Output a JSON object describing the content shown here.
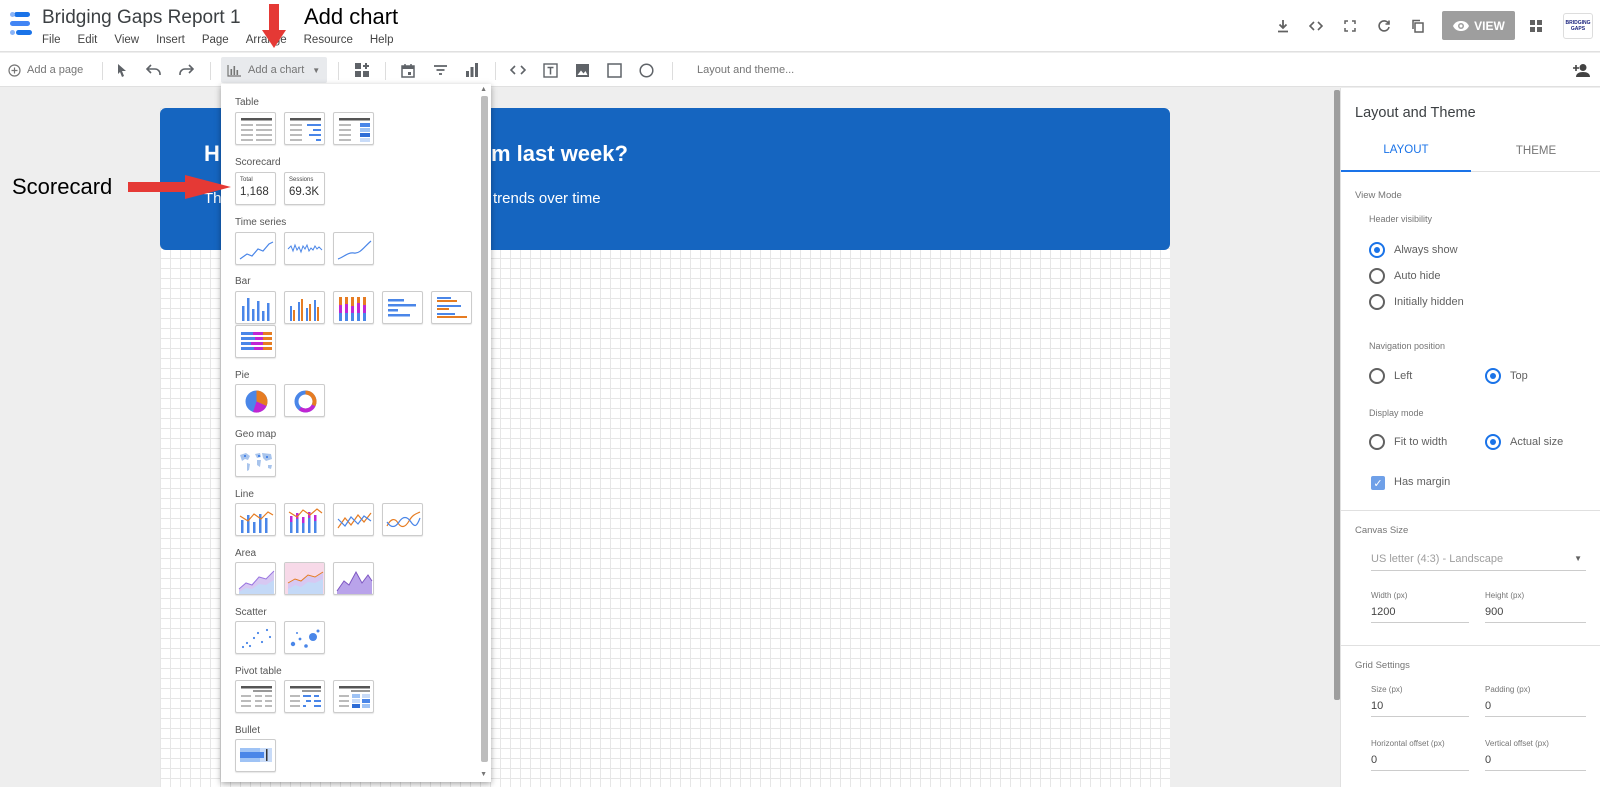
{
  "app": {
    "title": "Bridging Gaps Report 1",
    "brand_colors": [
      "#1a73e8",
      "#1565c0"
    ]
  },
  "menu": [
    "File",
    "Edit",
    "View",
    "Insert",
    "Page",
    "Arrange",
    "Resource",
    "Help"
  ],
  "header_actions": {
    "view_label": "VIEW",
    "logo_text": "BRIDGING GAPS"
  },
  "toolbar": {
    "add_page": "Add a page",
    "add_chart": "Add a chart",
    "layout_theme": "Layout and theme..."
  },
  "banner": {
    "title_left": "H",
    "title_right": "orm last week?",
    "sub_left": "Th",
    "sub_right": "trends over time"
  },
  "chart_menu": {
    "sections": {
      "table": "Table",
      "scorecard": "Scorecard",
      "time_series": "Time series",
      "bar": "Bar",
      "pie": "Pie",
      "geo": "Geo map",
      "line": "Line",
      "area": "Area",
      "scatter": "Scatter",
      "pivot": "Pivot table",
      "bullet": "Bullet"
    },
    "scorecards": [
      {
        "label": "Total",
        "value": "1,168"
      },
      {
        "label": "Sessions",
        "value": "69.3K"
      }
    ]
  },
  "panel": {
    "title": "Layout and Theme",
    "tabs": [
      "LAYOUT",
      "THEME"
    ],
    "view_mode": "View Mode",
    "header_visibility": "Header visibility",
    "header_options": [
      "Always show",
      "Auto hide",
      "Initially hidden"
    ],
    "nav_position": "Navigation position",
    "nav_options": [
      "Left",
      "Top"
    ],
    "display_mode": "Display mode",
    "display_options": [
      "Fit to width",
      "Actual size"
    ],
    "has_margin": "Has margin",
    "canvas_size": "Canvas Size",
    "canvas_select": "US letter (4:3) - Landscape",
    "width_label": "Width (px)",
    "width_value": "1200",
    "height_label": "Height (px)",
    "height_value": "900",
    "grid_settings": "Grid Settings",
    "size_label": "Size (px)",
    "size_value": "10",
    "padding_label": "Padding (px)",
    "padding_value": "0",
    "hoffset_label": "Horizontal offset (px)",
    "hoffset_value": "0",
    "voffset_label": "Vertical offset (px)",
    "voffset_value": "0"
  },
  "annotations": {
    "add_chart": "Add chart",
    "scorecard": "Scorecard",
    "arrow_color": "#e53935"
  }
}
